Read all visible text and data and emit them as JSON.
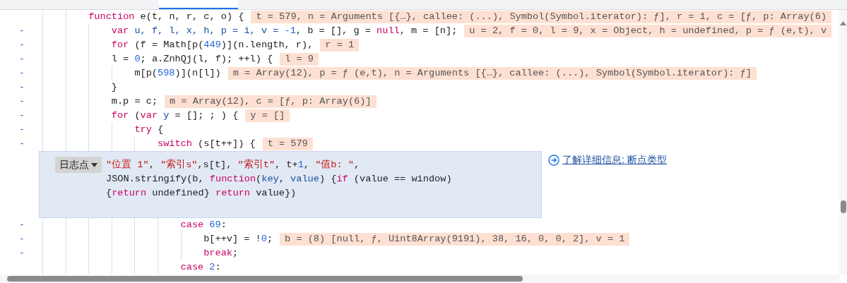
{
  "editor_tab": {
    "selected": true
  },
  "code": [
    {
      "tokens": [
        {
          "text": "function",
          "kind": "kw"
        },
        {
          "text": " e(t, n, r, c, o) {",
          "kind": "plain"
        }
      ],
      "value": "t = 579, n = Arguments [{…}, callee: (...), Symbol(Symbol.iterator): ƒ], r = 1, c = [ƒ, p: Array(6)",
      "children": [
        {
          "gutter": "-",
          "tokens": [
            {
              "text": "var",
              "kind": "kw"
            },
            {
              "text": " u, f, l, x, h, p = i, v = ",
              "kind": "decl"
            },
            {
              "text": "-1",
              "kind": "num"
            },
            {
              "text": ", b = [], g = ",
              "kind": "plain"
            },
            {
              "text": "null",
              "kind": "kw"
            },
            {
              "text": ", m = [n];",
              "kind": "plain"
            }
          ],
          "value": "u = 2, f = 0, l = 9, x = Object, h = undefined, p = ƒ (e,t), v"
        },
        {
          "gutter": "-",
          "tokens": [
            {
              "text": "for",
              "kind": "kw"
            },
            {
              "text": " (f = Math[p(",
              "kind": "plain"
            },
            {
              "text": "449",
              "kind": "num"
            },
            {
              "text": ")](n.length, r),",
              "kind": "plain"
            }
          ],
          "value": "r = 1"
        },
        {
          "gutter": "-",
          "tokens": [
            {
              "text": "l = ",
              "kind": "plain"
            },
            {
              "text": "0",
              "kind": "num"
            },
            {
              "text": "; a.ZnhQj(l, f); ++l) {",
              "kind": "plain"
            }
          ],
          "value": "l = 9",
          "children": [
            {
              "gutter": "-",
              "tokens": [
                {
                  "text": "m[p(",
                  "kind": "plain"
                },
                {
                  "text": "598",
                  "kind": "num"
                },
                {
                  "text": ")](n[l])",
                  "kind": "plain"
                }
              ],
              "value": "m = Array(12), p = ƒ (e,t), n = Arguments [{…}, callee: (...), Symbol(Symbol.iterator): ƒ]"
            }
          ]
        },
        {
          "gutter": "-",
          "tokens": [
            {
              "text": "}",
              "kind": "plain"
            }
          ]
        },
        {
          "gutter": "-",
          "tokens": [
            {
              "text": "m.p = c;",
              "kind": "plain"
            }
          ],
          "value": "m = Array(12), c = [ƒ, p: Array(6)]"
        },
        {
          "gutter": "-",
          "tokens": [
            {
              "text": "for",
              "kind": "kw"
            },
            {
              "text": " (",
              "kind": "plain"
            },
            {
              "text": "var",
              "kind": "kw"
            },
            {
              "text": " y",
              "kind": "decl"
            },
            {
              "text": " = []; ; ) {",
              "kind": "plain"
            }
          ],
          "value": "y = []",
          "children": [
            {
              "gutter": "-",
              "tokens": [
                {
                  "text": "try",
                  "kind": "kw"
                },
                {
                  "text": " {",
                  "kind": "plain"
                }
              ],
              "children": [
                {
                  "gutter": "-",
                  "tokens": [
                    {
                      "text": "switch",
                      "kind": "kw"
                    },
                    {
                      "text": " (s[t++]) {",
                      "kind": "plain"
                    }
                  ],
                  "value": "t = 579",
                  "logpoint": {
                    "type_label": "日志点",
                    "expression": [
                      [
                        {
                          "text": "\"位置 1\"",
                          "kind": "str"
                        },
                        {
                          "text": ", ",
                          "kind": "plain"
                        },
                        {
                          "text": "\"索引s\"",
                          "kind": "str"
                        },
                        {
                          "text": ",s[t], ",
                          "kind": "plain"
                        },
                        {
                          "text": "\"索引t\"",
                          "kind": "str"
                        },
                        {
                          "text": ", t+",
                          "kind": "plain"
                        },
                        {
                          "text": "1",
                          "kind": "num"
                        },
                        {
                          "text": ", ",
                          "kind": "plain"
                        },
                        {
                          "text": "\"值b: \"",
                          "kind": "str"
                        },
                        {
                          "text": ",",
                          "kind": "plain"
                        }
                      ],
                      [
                        {
                          "text": "JSON.stringify(b, ",
                          "kind": "plain"
                        },
                        {
                          "text": "function",
                          "kind": "kw"
                        },
                        {
                          "text": "(",
                          "kind": "plain"
                        },
                        {
                          "text": "key",
                          "kind": "decl"
                        },
                        {
                          "text": ", ",
                          "kind": "plain"
                        },
                        {
                          "text": "value",
                          "kind": "decl"
                        },
                        {
                          "text": ") {",
                          "kind": "plain"
                        },
                        {
                          "text": "if",
                          "kind": "kw"
                        },
                        {
                          "text": " (value == window)",
                          "kind": "plain"
                        }
                      ],
                      [
                        {
                          "text": "{",
                          "kind": "plain"
                        },
                        {
                          "text": "return",
                          "kind": "kw"
                        },
                        {
                          "text": " undefined} ",
                          "kind": "plain"
                        },
                        {
                          "text": "return",
                          "kind": "kw"
                        },
                        {
                          "text": " value})",
                          "kind": "plain"
                        }
                      ]
                    ],
                    "link": "了解详细信息: 断点类型"
                  },
                  "children": [
                    {
                      "gutter": "-",
                      "tokens": [
                        {
                          "text": "case",
                          "kind": "kw"
                        },
                        {
                          "text": " 69",
                          "kind": "num"
                        },
                        {
                          "text": ":",
                          "kind": "plain"
                        }
                      ],
                      "children": [
                        {
                          "gutter": "-",
                          "tokens": [
                            {
                              "text": "b[++v] = !",
                              "kind": "plain"
                            },
                            {
                              "text": "0",
                              "kind": "num"
                            },
                            {
                              "text": ";",
                              "kind": "plain"
                            }
                          ],
                          "value": "b = (8) [null, ƒ, Uint8Array(9191), 38, 16, 0, 0, 2], v = 1"
                        },
                        {
                          "gutter": "-",
                          "tokens": [
                            {
                              "text": "break",
                              "kind": "kw"
                            },
                            {
                              "text": ";",
                              "kind": "plain"
                            }
                          ]
                        }
                      ]
                    },
                    {
                      "tokens": [
                        {
                          "text": "case",
                          "kind": "kw"
                        },
                        {
                          "text": " 2",
                          "kind": "num"
                        },
                        {
                          "text": ":",
                          "kind": "plain"
                        }
                      ]
                    }
                  ]
                }
              ]
            }
          ]
        }
      ]
    }
  ]
}
